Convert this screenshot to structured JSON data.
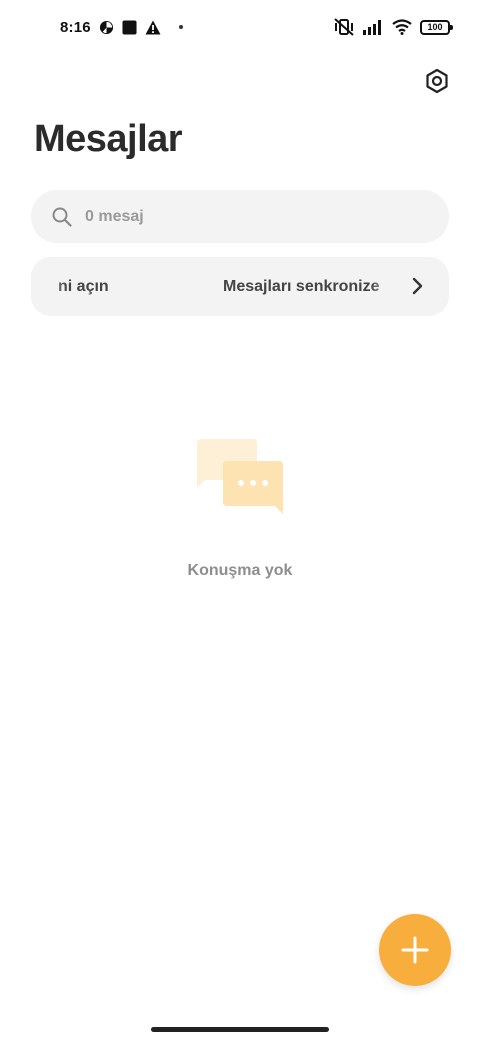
{
  "status_bar": {
    "time": "8:16",
    "battery": "100"
  },
  "header": {
    "title": "Mesajlar"
  },
  "search": {
    "placeholder": "0 mesaj"
  },
  "sync_banner": {
    "left_text": "ni açın",
    "main_text": "Mesajları senkronize"
  },
  "empty_state": {
    "label": "Konuşma yok"
  },
  "colors": {
    "accent": "#f8ae3c",
    "bubble_back": "#fdf0d6",
    "bubble_front": "#fde2b2"
  }
}
